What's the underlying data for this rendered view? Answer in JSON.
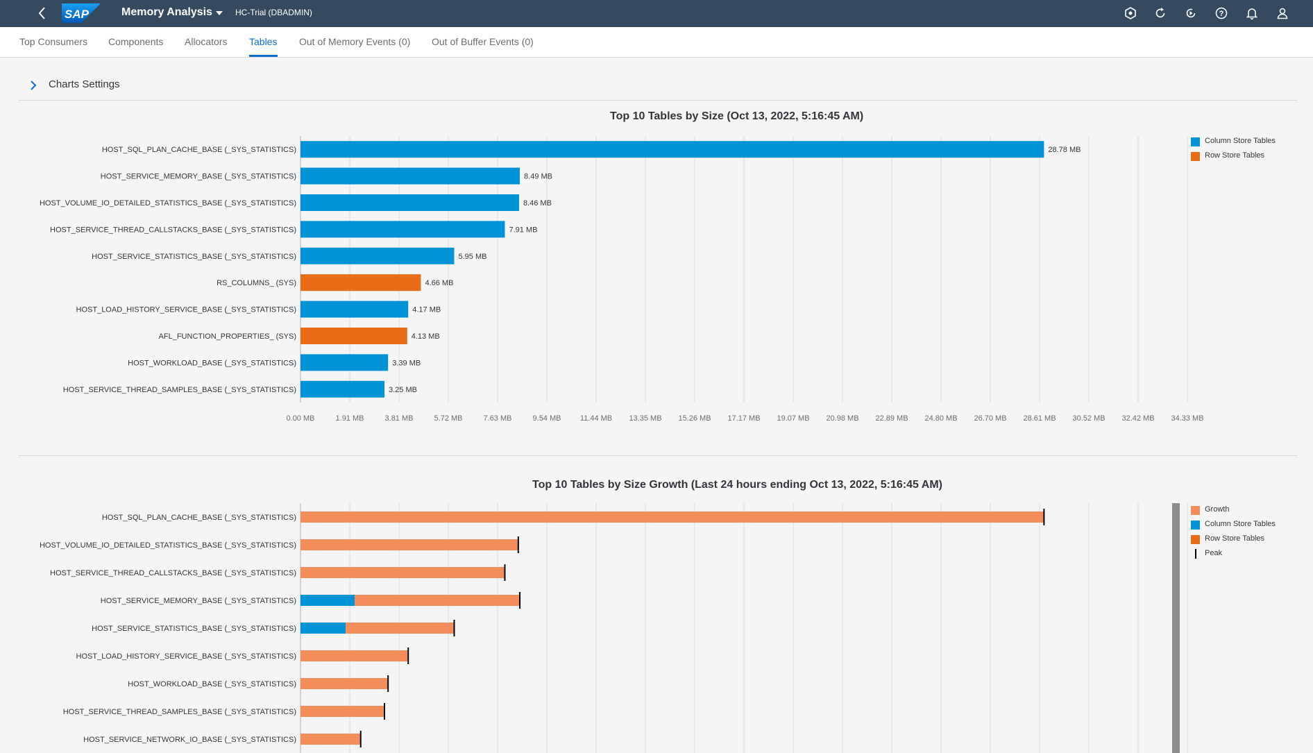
{
  "shell": {
    "app_title": "Memory Analysis",
    "system": "HC-Trial (DBADMIN)",
    "icons": [
      "back-icon",
      "sap-logo",
      "plugin-icon",
      "refresh-icon",
      "auto-refresh-icon",
      "help-icon",
      "notifications-icon",
      "user-icon"
    ]
  },
  "tabs": [
    "Top Consumers",
    "Components",
    "Allocators",
    "Tables",
    "Out of Memory Events (0)",
    "Out of Buffer Events (0)"
  ],
  "active_tab": "Tables",
  "settings_label": "Charts Settings",
  "colors": {
    "column_store": "#0093d6",
    "row_store": "#e96c16",
    "growth": "#f38d5c",
    "peak": "#000000",
    "shellbar": "#354a5f",
    "accent": "#0a6ed1"
  },
  "chart_data": [
    {
      "type": "bar",
      "orientation": "horizontal",
      "title": "Top 10 Tables by Size (Oct 13, 2022, 5:16:45 AM)",
      "categories": [
        "HOST_SQL_PLAN_CACHE_BASE (_SYS_STATISTICS)",
        "HOST_SERVICE_MEMORY_BASE (_SYS_STATISTICS)",
        "HOST_VOLUME_IO_DETAILED_STATISTICS_BASE (_SYS_STATISTICS)",
        "HOST_SERVICE_THREAD_CALLSTACKS_BASE (_SYS_STATISTICS)",
        "HOST_SERVICE_STATISTICS_BASE (_SYS_STATISTICS)",
        "RS_COLUMNS_ (SYS)",
        "HOST_LOAD_HISTORY_SERVICE_BASE (_SYS_STATISTICS)",
        "AFL_FUNCTION_PROPERTIES_ (SYS)",
        "HOST_WORKLOAD_BASE (_SYS_STATISTICS)",
        "HOST_SERVICE_THREAD_SAMPLES_BASE (_SYS_STATISTICS)"
      ],
      "values": [
        28.78,
        8.49,
        8.46,
        7.91,
        5.95,
        4.66,
        4.17,
        4.13,
        3.39,
        3.25
      ],
      "value_labels": [
        "28.78 MB",
        "8.49 MB",
        "8.46 MB",
        "7.91 MB",
        "5.95 MB",
        "4.66 MB",
        "4.17 MB",
        "4.13 MB",
        "3.39 MB",
        "3.25 MB"
      ],
      "store": [
        "column",
        "column",
        "column",
        "column",
        "column",
        "row",
        "column",
        "row",
        "column",
        "column"
      ],
      "x_ticks": [
        "0.00 MB",
        "1.91 MB",
        "3.81 MB",
        "5.72 MB",
        "7.63 MB",
        "9.54 MB",
        "11.44 MB",
        "13.35 MB",
        "15.26 MB",
        "17.17 MB",
        "19.07 MB",
        "20.98 MB",
        "22.89 MB",
        "24.80 MB",
        "26.70 MB",
        "28.61 MB",
        "30.52 MB",
        "32.42 MB",
        "34.33 MB"
      ],
      "xlim": [
        0,
        34.33
      ],
      "grid": true,
      "legend_position": "right",
      "legend": [
        "Column Store Tables",
        "Row Store Tables"
      ]
    },
    {
      "type": "bar",
      "orientation": "horizontal",
      "stacked": true,
      "title": "Top 10 Tables by Size Growth (Last 24 hours ending Oct 13, 2022, 5:16:45 AM)",
      "categories": [
        "HOST_SQL_PLAN_CACHE_BASE (_SYS_STATISTICS)",
        "HOST_VOLUME_IO_DETAILED_STATISTICS_BASE (_SYS_STATISTICS)",
        "HOST_SERVICE_THREAD_CALLSTACKS_BASE (_SYS_STATISTICS)",
        "HOST_SERVICE_MEMORY_BASE (_SYS_STATISTICS)",
        "HOST_SERVICE_STATISTICS_BASE (_SYS_STATISTICS)",
        "HOST_LOAD_HISTORY_SERVICE_BASE (_SYS_STATISTICS)",
        "HOST_WORKLOAD_BASE (_SYS_STATISTICS)",
        "HOST_SERVICE_THREAD_SAMPLES_BASE (_SYS_STATISTICS)",
        "HOST_SERVICE_NETWORK_IO_BASE (_SYS_STATISTICS)"
      ],
      "series": [
        {
          "name": "Column Store Tables",
          "values": [
            0,
            0,
            0,
            2.1,
            1.75,
            0,
            0,
            0,
            0
          ]
        },
        {
          "name": "Growth",
          "values": [
            28.78,
            8.43,
            7.91,
            6.39,
            4.2,
            4.17,
            3.39,
            3.25,
            2.33
          ]
        }
      ],
      "peak": [
        28.78,
        8.43,
        7.91,
        8.49,
        5.95,
        4.17,
        3.39,
        3.25,
        2.33
      ],
      "xlim": [
        0,
        34.33
      ],
      "grid": true,
      "legend_position": "right",
      "legend": [
        "Growth",
        "Column Store Tables",
        "Row Store Tables",
        "Peak"
      ]
    }
  ]
}
